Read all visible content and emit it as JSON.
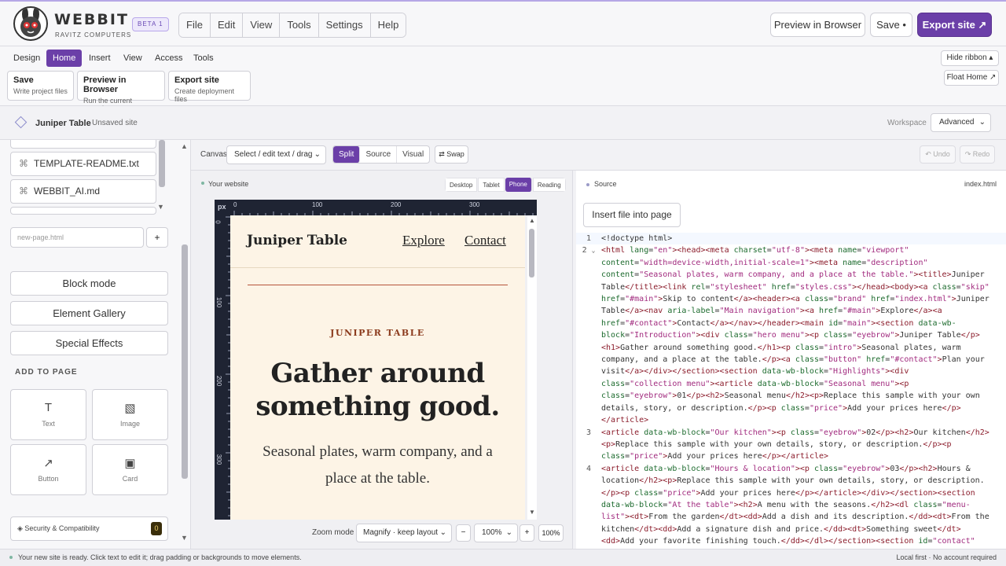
{
  "app": {
    "brand": "WEBBIT",
    "brand_sub": "RAVITZ COMPUTERS",
    "beta": "BETA 1",
    "menu": [
      "File",
      "Edit",
      "View",
      "Tools",
      "Settings",
      "Help"
    ],
    "preview_btn": "Preview in Browser",
    "save_btn": "Save •",
    "export_btn": "Export site ↗"
  },
  "ribbon": {
    "tabs": [
      "Design",
      "Home",
      "Insert",
      "View",
      "Access",
      "Tools"
    ],
    "active_tab": "Home",
    "cards": [
      {
        "title": "Save",
        "sub": "Write project files"
      },
      {
        "title": "Preview in Browser",
        "sub": "Run the current snapshot"
      },
      {
        "title": "Export site",
        "sub": "Create deployment files"
      }
    ],
    "hide_ribbon": "Hide ribbon ▴",
    "float_home": "Float Home ↗"
  },
  "site": {
    "name": "Juniper Table",
    "status": "Unsaved site",
    "workspace_label": "Workspace",
    "workspace_value": "Advanced"
  },
  "sidebar": {
    "files": [
      "TEMPLATE-README.txt",
      "WEBBIT_AI.md"
    ],
    "new_page_placeholder": "new-page.html",
    "add_btn": "+",
    "buttons": [
      "Block mode",
      "Element Gallery",
      "Special Effects"
    ],
    "add_to_page": "ADD TO PAGE",
    "tiles": [
      {
        "icon": "T",
        "label": "Text"
      },
      {
        "icon": "▧",
        "label": "Image"
      },
      {
        "icon": "↗",
        "label": "Button"
      },
      {
        "icon": "▣",
        "label": "Card"
      }
    ],
    "security": "◈ Security & Compatibility",
    "security_count": "0"
  },
  "canvasbar": {
    "label": "Canvas",
    "mode": "Select / edit text / drag",
    "views": [
      "Split",
      "Source",
      "Visual"
    ],
    "active_view": "Split",
    "swap": "⇄ Swap",
    "undo": "↶ Undo",
    "redo": "↷ Redo"
  },
  "preview": {
    "title": "Your website",
    "devices": [
      "Desktop",
      "Tablet",
      "Phone",
      "Reading"
    ],
    "active_device": "Phone",
    "ruler_unit": "px",
    "ruler_h": [
      "0",
      "100",
      "200",
      "300"
    ],
    "ruler_v": [
      "0",
      "100",
      "200",
      "300"
    ],
    "zoom_label": "Zoom mode",
    "zoom_mode": "Magnify · keep layout",
    "zoom_minus": "−",
    "zoom_value": "100%",
    "zoom_plus": "+",
    "zoom_reset": "100%"
  },
  "site_preview": {
    "brand": "Juniper Table",
    "nav": [
      "Explore",
      "Contact"
    ],
    "eyebrow": "JUNIPER TABLE",
    "headline": "Gather around something good.",
    "intro": "Seasonal plates, warm company, and a place at the table."
  },
  "source": {
    "title": "Source",
    "file": "index.html",
    "insert_btn": "Insert file into page"
  },
  "status": {
    "left": "Your new site is ready. Click text to edit it; drag padding or backgrounds to move elements.",
    "right": "Local first · No account required"
  },
  "colors": {
    "accent": "#6b3fa8",
    "site_bg": "#fdf4e6",
    "eyebrow": "#8b3a1c"
  }
}
